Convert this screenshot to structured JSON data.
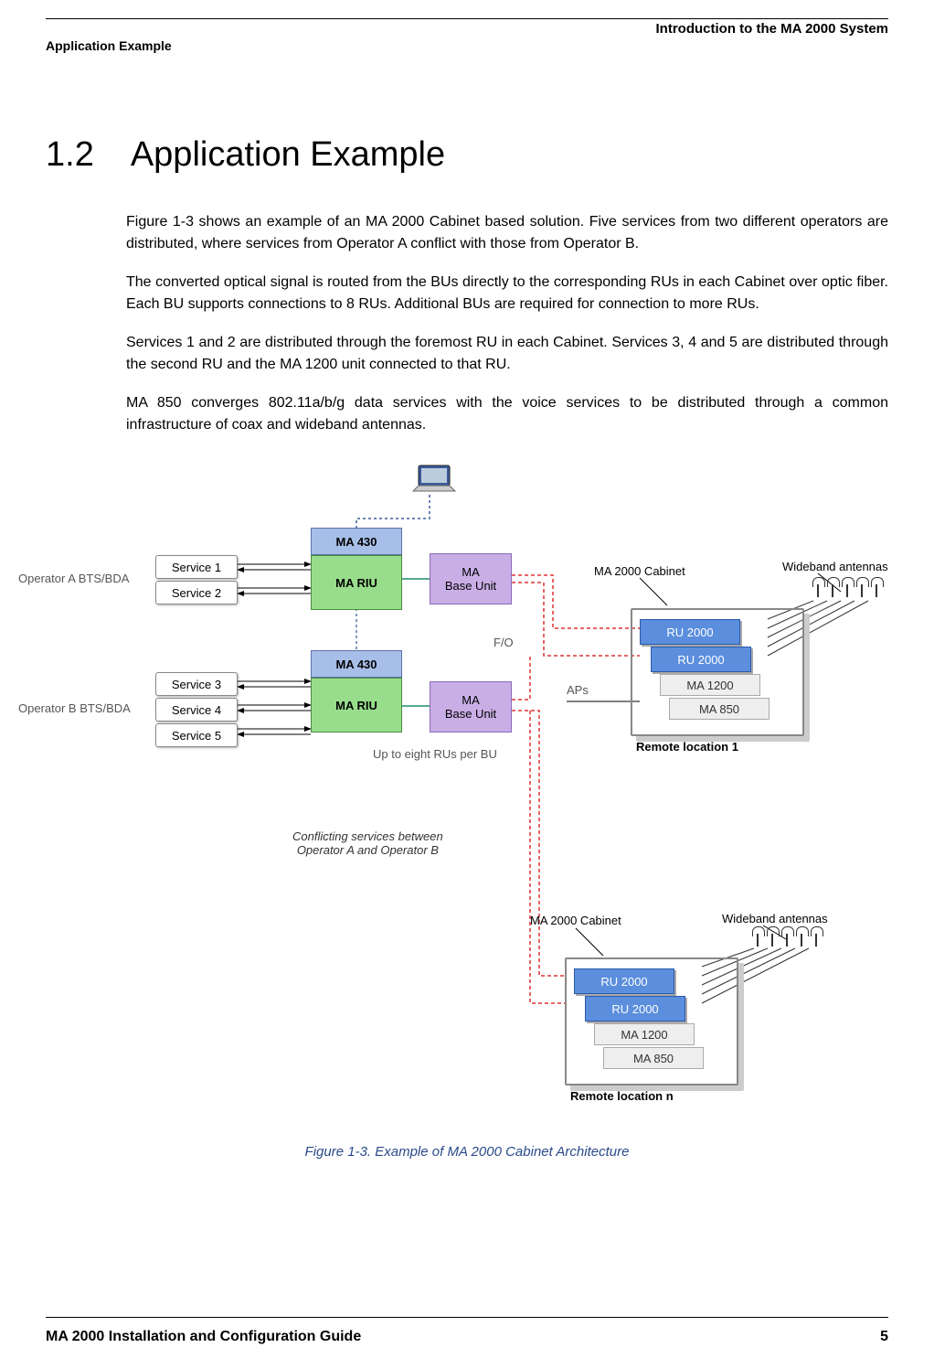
{
  "header": {
    "chapter": "Introduction to the MA 2000 System",
    "section_label": "Application Example"
  },
  "section": {
    "number": "1.2",
    "title": "Application Example"
  },
  "paragraphs": {
    "p1": "Figure 1-3 shows an example of an MA 2000 Cabinet based solution. Five services from two different operators are distributed, where services from Operator A conflict with those from Operator B.",
    "p2": "The converted optical signal is routed from the BUs directly to the corresponding RUs in each Cabinet over optic fiber. Each BU supports connections to 8 RUs. Additional BUs are required for connection to more RUs.",
    "p3": "Services 1 and 2 are distributed through the foremost RU in each Cabinet. Services 3, 4 and 5 are distributed through the second RU and the MA 1200 unit connected to that RU.",
    "p4": "MA 850 converges 802.11a/b/g data services with the voice services to be distributed through a common infrastructure of coax and wideband antennas."
  },
  "diagram": {
    "operator_a": "Operator A BTS/BDA",
    "operator_b": "Operator B BTS/BDA",
    "service1": "Service 1",
    "service2": "Service 2",
    "service3": "Service 3",
    "service4": "Service 4",
    "service5": "Service 5",
    "ma_riu": "MA RIU",
    "ma_430": "MA 430",
    "ma_base_unit": "MA\nBase Unit",
    "fo": "F/O",
    "aps": "APs",
    "up_to_eight": "Up to eight RUs per BU",
    "conflict_note": "Conflicting services between\nOperator A  and Operator B",
    "cabinet_label": "MA 2000 Cabinet",
    "wideband": "Wideband antennas",
    "ru2000": "RU 2000",
    "ma1200": "MA 1200",
    "ma850": "MA 850",
    "remote1": "Remote location 1",
    "remoten": "Remote location n"
  },
  "figure_caption": "Figure 1-3. Example of MA 2000 Cabinet Architecture",
  "footer": {
    "doc_title": "MA 2000 Installation and Configuration Guide",
    "page": "5"
  }
}
